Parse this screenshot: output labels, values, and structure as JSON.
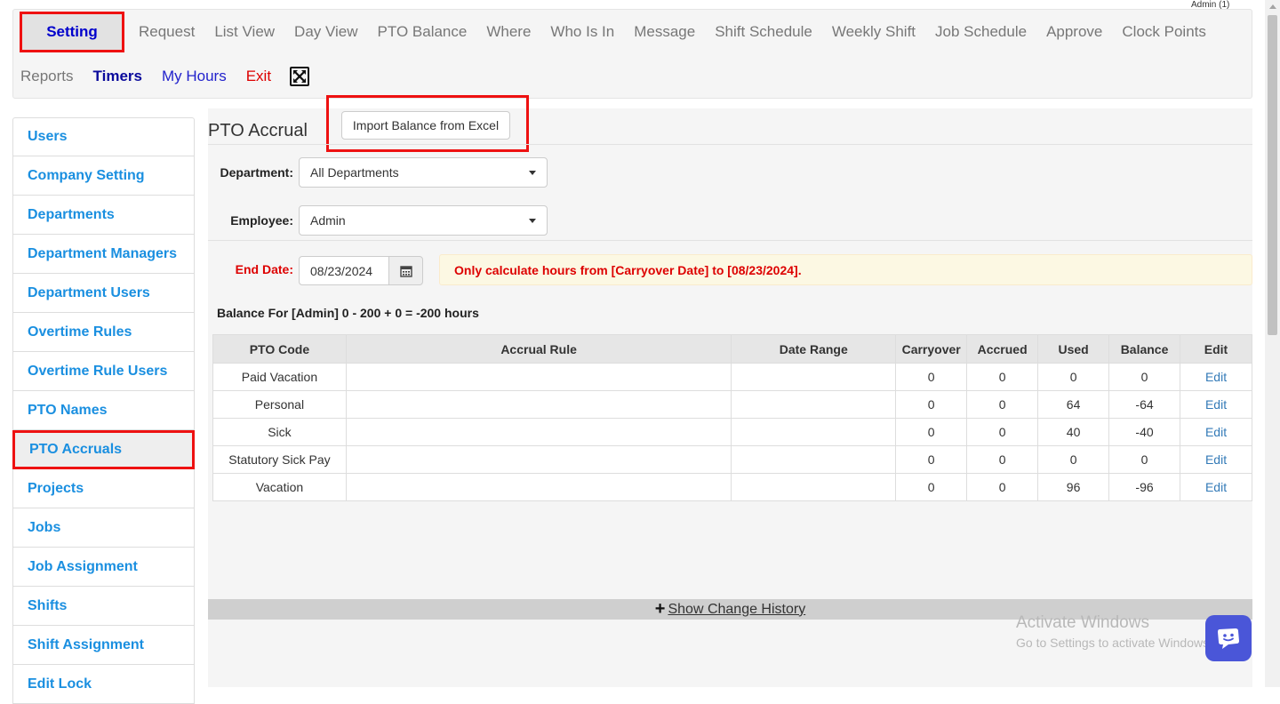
{
  "header": {
    "admin_label": "Admin (1)"
  },
  "nav": {
    "row1": [
      "Setting",
      "Request",
      "List View",
      "Day View",
      "PTO Balance",
      "Where",
      "Who Is In",
      "Message",
      "Shift Schedule",
      "Weekly Shift",
      "Job Schedule",
      "Approve",
      "Clock Points"
    ],
    "row2": {
      "reports": "Reports",
      "timers": "Timers",
      "my_hours": "My Hours",
      "exit": "Exit"
    },
    "fullscreen_icon": "fullscreen-icon"
  },
  "sidebar": {
    "items": [
      "Users",
      "Company Setting",
      "Departments",
      "Department Managers",
      "Department Users",
      "Overtime Rules",
      "Overtime Rule Users",
      "PTO Names",
      "PTO Accruals",
      "Projects",
      "Jobs",
      "Job Assignment",
      "Shifts",
      "Shift Assignment",
      "Edit Lock"
    ],
    "active": "PTO Accruals"
  },
  "main": {
    "title": "PTO Accrual",
    "import_button": "Import Balance from Excel",
    "department": {
      "label": "Department:",
      "value": "All Departments"
    },
    "employee": {
      "label": "Employee:",
      "value": "Admin"
    },
    "end_date": {
      "label": "End Date:",
      "value": "08/23/2024"
    },
    "notice": "Only calculate hours from [Carryover Date] to [08/23/2024].",
    "balance_summary": "Balance For [Admin] 0 - 200 + 0 = -200 hours",
    "table": {
      "headers": [
        "PTO Code",
        "Accrual Rule",
        "Date Range",
        "Carryover",
        "Accrued",
        "Used",
        "Balance",
        "Edit"
      ],
      "rows": [
        [
          "Paid Vacation",
          "",
          "",
          "0",
          "0",
          "0",
          "0",
          "Edit"
        ],
        [
          "Personal",
          "",
          "",
          "0",
          "0",
          "64",
          "-64",
          "Edit"
        ],
        [
          "Sick",
          "",
          "",
          "0",
          "0",
          "40",
          "-40",
          "Edit"
        ],
        [
          "Statutory Sick Pay",
          "",
          "",
          "0",
          "0",
          "0",
          "0",
          "Edit"
        ],
        [
          "Vacation",
          "",
          "",
          "0",
          "0",
          "96",
          "-96",
          "Edit"
        ]
      ]
    },
    "history_link": "Show Change History"
  },
  "watermark": {
    "line1": "Activate Windows",
    "line2": "Go to Settings to activate Windows."
  },
  "colors": {
    "highlight": "#ee1111",
    "link": "#1a8fe0",
    "nav_active": "#0000cc",
    "notice_text": "#dd0000"
  }
}
